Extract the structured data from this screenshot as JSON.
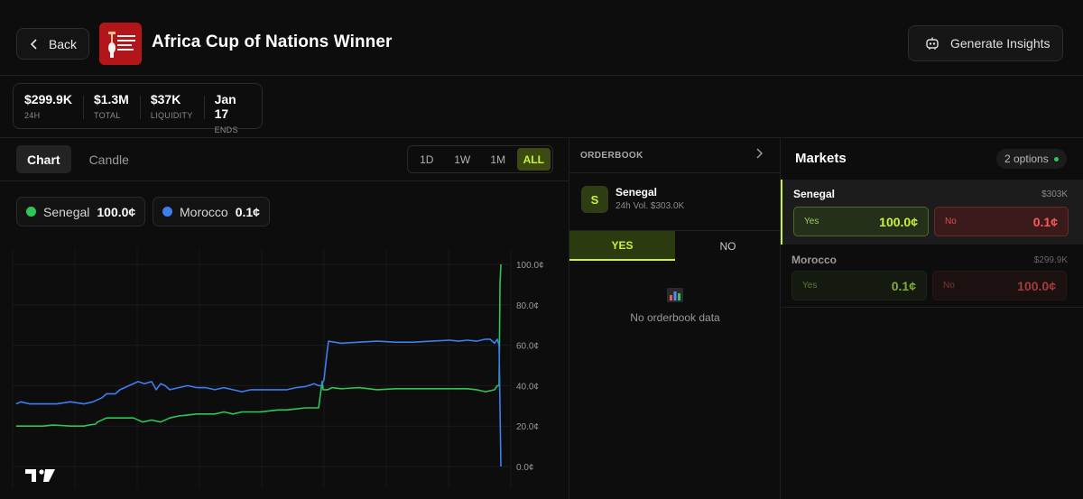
{
  "header": {
    "back_label": "Back",
    "title": "Africa Cup of Nations Winner",
    "insights_label": "Generate Insights"
  },
  "stats": [
    {
      "value": "$299.9K",
      "label": "24H"
    },
    {
      "value": "$1.3M",
      "label": "TOTAL"
    },
    {
      "value": "$37K",
      "label": "LIQUIDITY"
    },
    {
      "value": "Jan 17",
      "label": "ENDS"
    }
  ],
  "chart_panel": {
    "tabs": [
      {
        "label": "Chart",
        "active": true
      },
      {
        "label": "Candle",
        "active": false
      }
    ],
    "ranges": [
      {
        "label": "1D",
        "active": false
      },
      {
        "label": "1W",
        "active": false
      },
      {
        "label": "1M",
        "active": false
      },
      {
        "label": "ALL",
        "active": true
      }
    ],
    "legend": [
      {
        "name": "Senegal",
        "value": "100.0¢",
        "color": "#2ec55a"
      },
      {
        "name": "Morocco",
        "value": "0.1¢",
        "color": "#3d7ef0"
      }
    ]
  },
  "chart_data": {
    "type": "line",
    "ylim": [
      0,
      100
    ],
    "y_ticks": [
      "100.0¢",
      "80.0¢",
      "60.0¢",
      "40.0¢",
      "20.0¢",
      "0.0¢"
    ],
    "grid": true,
    "series": [
      {
        "name": "Senegal",
        "color": "#2ec55a",
        "x": [
          0,
          10,
          20,
          30,
          40,
          50,
          60,
          70,
          75,
          80,
          88,
          90,
          100,
          110,
          120,
          130,
          140,
          150,
          160,
          170,
          180,
          190,
          200,
          210,
          220,
          230,
          240,
          250,
          260,
          270,
          280,
          290,
          300,
          310,
          320,
          330,
          335,
          339,
          340,
          345,
          350,
          360,
          380,
          400,
          420,
          440,
          460,
          480,
          500,
          510,
          520,
          530,
          533,
          535,
          536,
          537
        ],
        "values": [
          20,
          20,
          20,
          20,
          20.5,
          20.3,
          20,
          20,
          20,
          20.5,
          21,
          22,
          24,
          24,
          24,
          24,
          22,
          23,
          22,
          24,
          25,
          25.5,
          26,
          26,
          26,
          27,
          26,
          27,
          27,
          27,
          27.5,
          28,
          28,
          28.5,
          29,
          29,
          29,
          42,
          38,
          38,
          39,
          38.5,
          39,
          38,
          38.5,
          38.5,
          38.5,
          38.5,
          38.5,
          38,
          37,
          38,
          40,
          40,
          90,
          100
        ]
      },
      {
        "name": "Morocco",
        "color": "#3d7ef0",
        "x": [
          0,
          5,
          15,
          30,
          45,
          60,
          75,
          85,
          95,
          100,
          110,
          115,
          125,
          135,
          142,
          150,
          155,
          160,
          165,
          170,
          180,
          190,
          200,
          210,
          220,
          230,
          240,
          250,
          260,
          270,
          280,
          290,
          300,
          310,
          320,
          330,
          335,
          338,
          341,
          344,
          346,
          360,
          380,
          400,
          420,
          440,
          460,
          480,
          490,
          500,
          510,
          520,
          525,
          530,
          533,
          535,
          536,
          537
        ],
        "values": [
          31,
          32,
          31,
          31,
          31,
          32,
          31,
          32,
          34,
          36,
          36,
          38,
          40,
          42,
          41,
          42,
          38,
          41,
          40,
          38,
          39,
          40,
          39,
          39,
          38,
          39,
          38,
          37,
          38,
          38,
          38,
          38,
          38,
          39,
          39.5,
          41,
          40,
          40,
          43,
          55,
          62,
          61,
          61.5,
          62,
          61.5,
          61.5,
          62,
          62.5,
          62,
          62.5,
          62,
          63,
          63,
          61,
          63,
          60,
          30,
          0
        ]
      }
    ]
  },
  "orderbook": {
    "title": "ORDERBOOK",
    "outcome_initial": "S",
    "outcome_name": "Senegal",
    "outcome_volume": "24h Vol. $303.0K",
    "tabs": [
      {
        "label": "YES",
        "active": true
      },
      {
        "label": "NO",
        "active": false
      }
    ],
    "empty_text": "No orderbook data"
  },
  "markets": {
    "title": "Markets",
    "options_badge": "2 options",
    "items": [
      {
        "name": "Senegal",
        "volume": "$303K",
        "yes_label": "Yes",
        "yes_price": "100.0¢",
        "no_label": "No",
        "no_price": "0.1¢",
        "selected": true
      },
      {
        "name": "Morocco",
        "volume": "$299.9K",
        "yes_label": "Yes",
        "yes_price": "0.1¢",
        "no_label": "No",
        "no_price": "100.0¢",
        "selected": false
      }
    ]
  }
}
